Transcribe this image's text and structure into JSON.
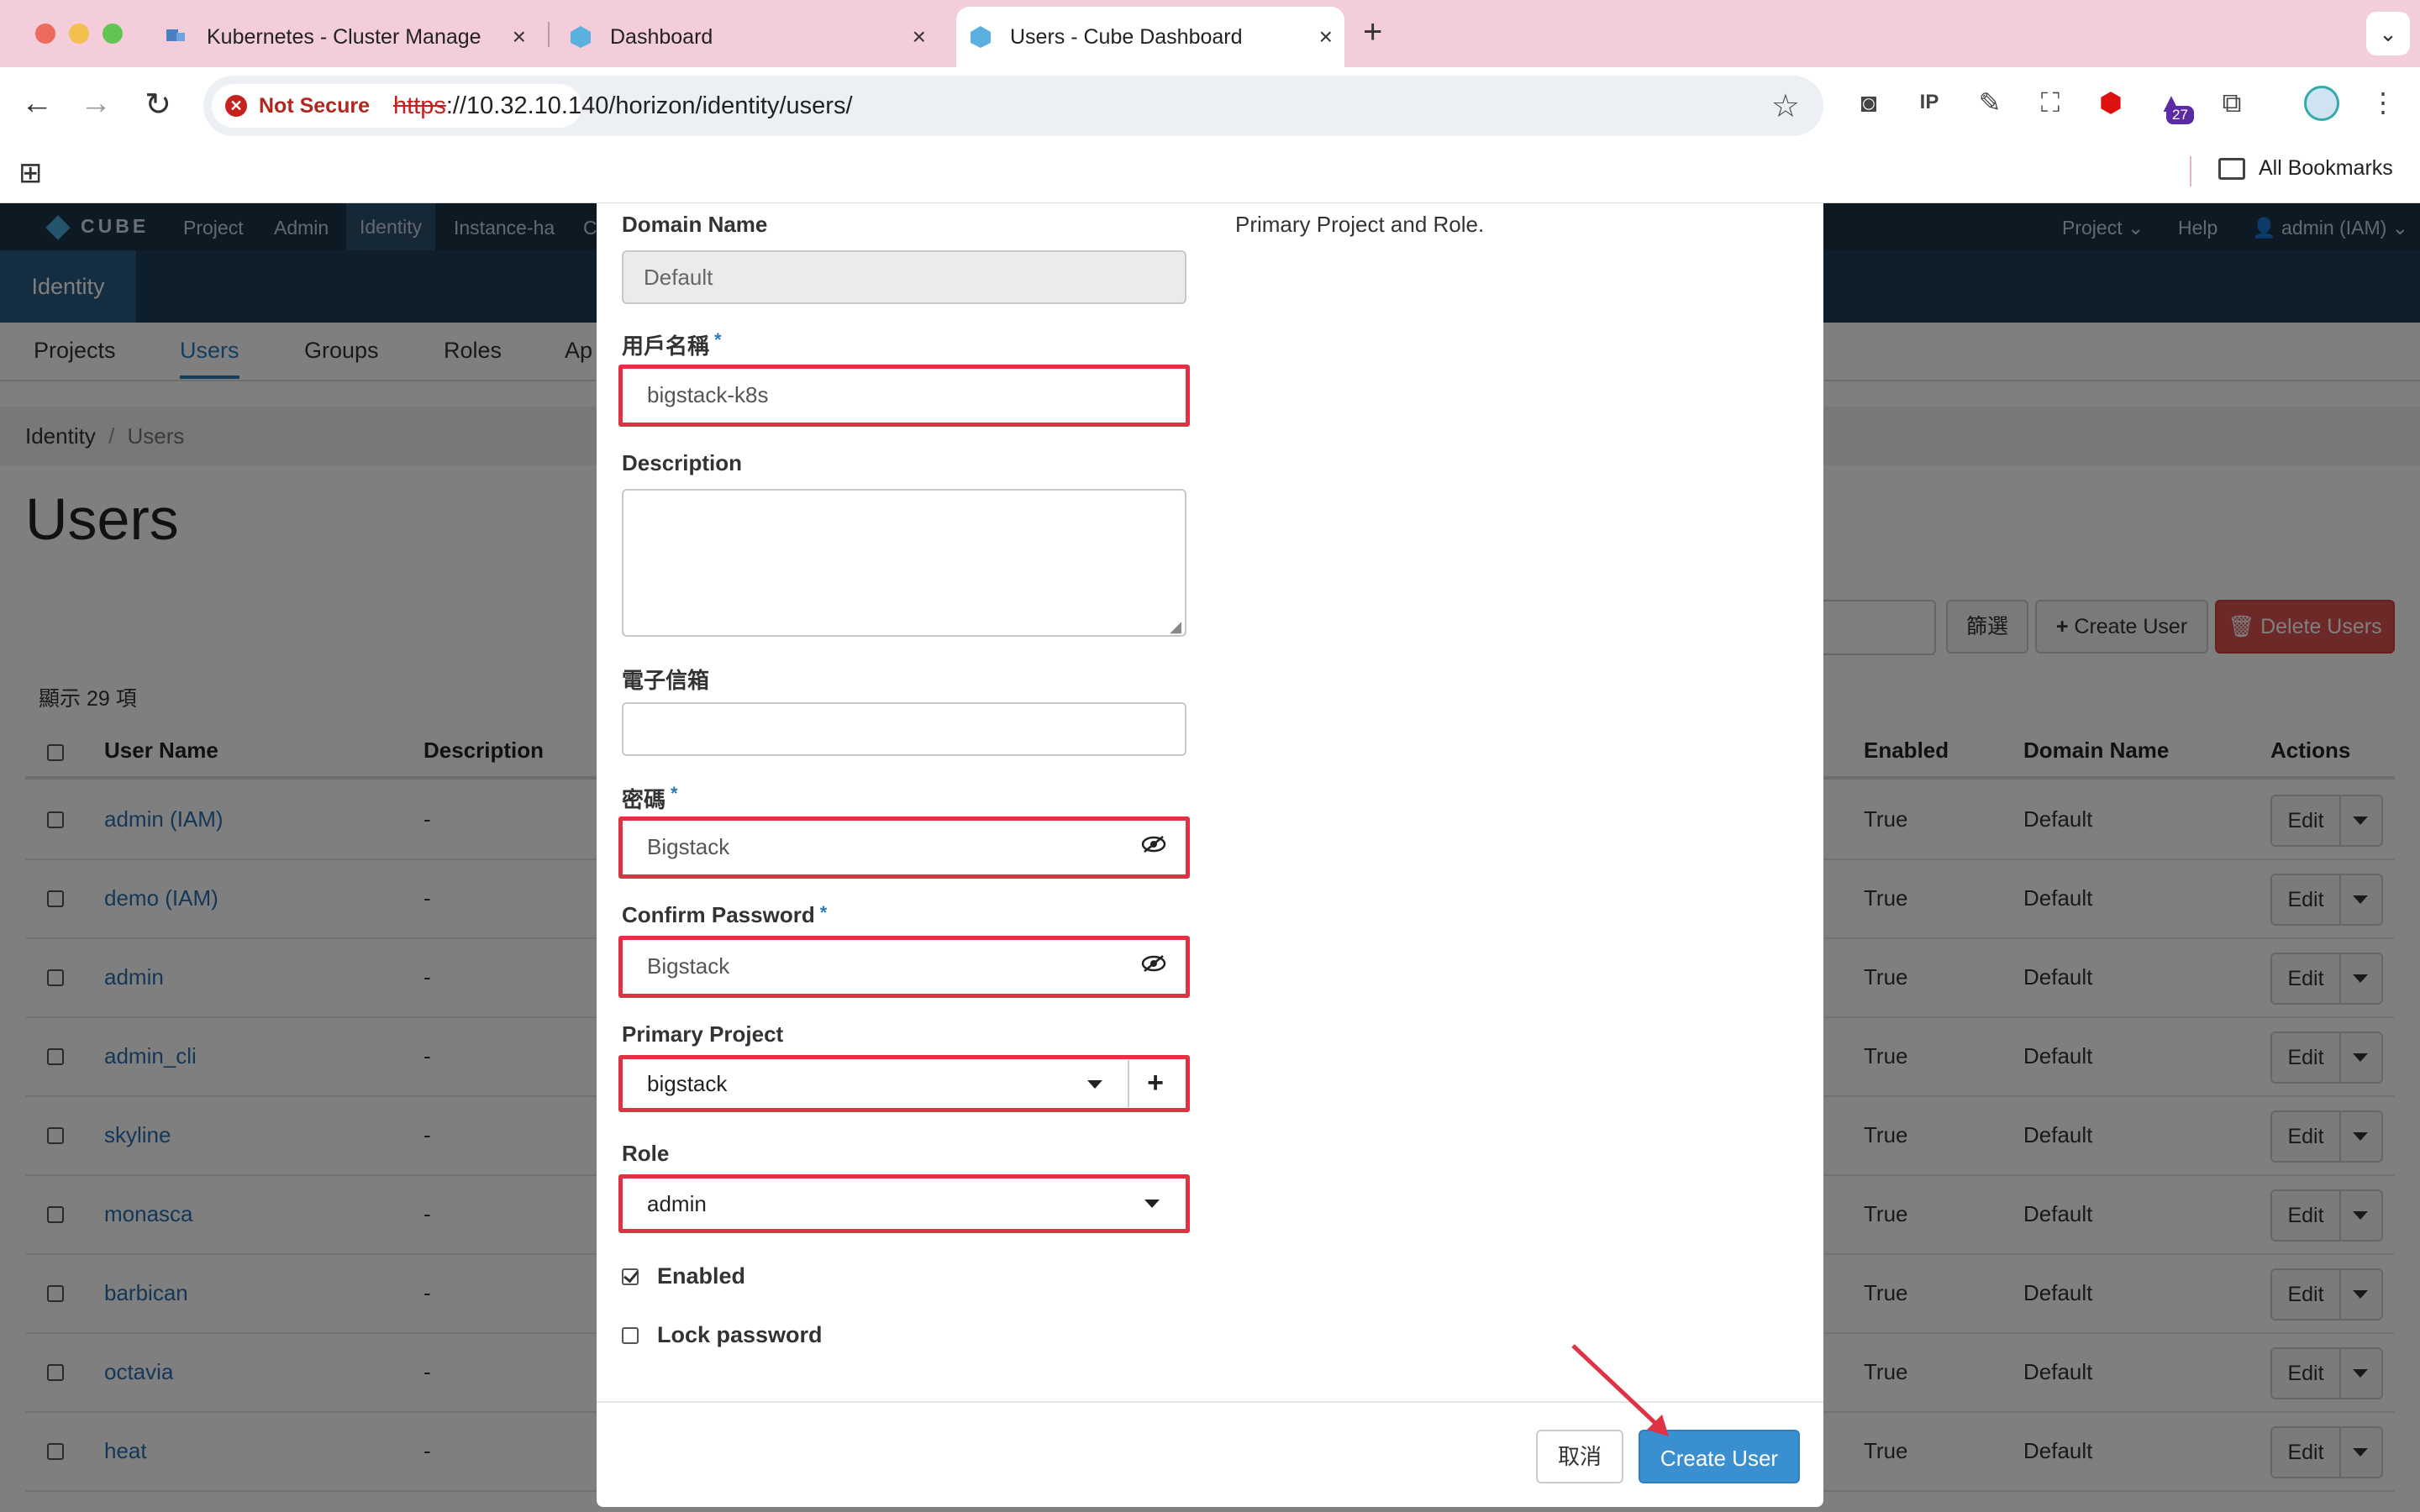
{
  "browser": {
    "tabs": [
      {
        "title": "Kubernetes - Cluster Manage",
        "active": false
      },
      {
        "title": "Dashboard",
        "active": false
      },
      {
        "title": "Users - Cube Dashboard",
        "active": true
      }
    ],
    "security_label": "Not Secure",
    "url_scheme": "https",
    "url_rest": "://10.32.10.140/horizon/identity/users/",
    "extension_badge": "27",
    "bookmarks_label": "All Bookmarks"
  },
  "app": {
    "logo": "CUBE",
    "nav": [
      "Project",
      "Admin",
      "Identity",
      "Instance-ha",
      "C"
    ],
    "nav_right": {
      "project": "Project",
      "help": "Help",
      "user": "admin (IAM)"
    },
    "section": "Identity",
    "subtabs": [
      "Projects",
      "Users",
      "Groups",
      "Roles",
      "Ap"
    ],
    "breadcrumb": {
      "root": "Identity",
      "separator": "/",
      "current": "Users"
    },
    "page_title": "Users",
    "actions": {
      "filter": "篩選",
      "create": "Create User",
      "delete": "Delete Users"
    },
    "count_text": "顯示 29 項",
    "table": {
      "headers": {
        "name": "User Name",
        "description": "Description",
        "enabled": "Enabled",
        "domain": "Domain Name",
        "actions": "Actions"
      },
      "edit_label": "Edit",
      "rows": [
        {
          "name": "admin (IAM)",
          "description": "-",
          "enabled": "True",
          "domain": "Default"
        },
        {
          "name": "demo (IAM)",
          "description": "-",
          "enabled": "True",
          "domain": "Default"
        },
        {
          "name": "admin",
          "description": "-",
          "enabled": "True",
          "domain": "Default"
        },
        {
          "name": "admin_cli",
          "description": "-",
          "enabled": "True",
          "domain": "Default"
        },
        {
          "name": "skyline",
          "description": "-",
          "enabled": "True",
          "domain": "Default"
        },
        {
          "name": "monasca",
          "description": "-",
          "enabled": "True",
          "domain": "Default"
        },
        {
          "name": "barbican",
          "description": "-",
          "enabled": "True",
          "domain": "Default"
        },
        {
          "name": "octavia",
          "description": "-",
          "enabled": "True",
          "domain": "Default"
        },
        {
          "name": "heat",
          "description": "-",
          "enabled": "True",
          "domain": "Default"
        }
      ]
    }
  },
  "modal": {
    "help_text": "Primary Project and Role.",
    "domain_label": "Domain Name",
    "domain_value": "Default",
    "username_label": "用戶名稱",
    "username_value": "bigstack-k8s",
    "description_label": "Description",
    "email_label": "電子信箱",
    "password_label": "密碼",
    "password_value": "Bigstack",
    "confirm_label": "Confirm Password",
    "confirm_value": "Bigstack",
    "project_label": "Primary Project",
    "project_value": "bigstack",
    "role_label": "Role",
    "role_value": "admin",
    "enabled_label": "Enabled",
    "enabled_checked": true,
    "lock_label": "Lock password",
    "lock_checked": false,
    "required_mark": "*",
    "cancel_label": "取消",
    "submit_label": "Create User"
  },
  "colors": {
    "highlight": "#e03245",
    "primary": "#3a8fd0",
    "nav": "#1d3447"
  }
}
